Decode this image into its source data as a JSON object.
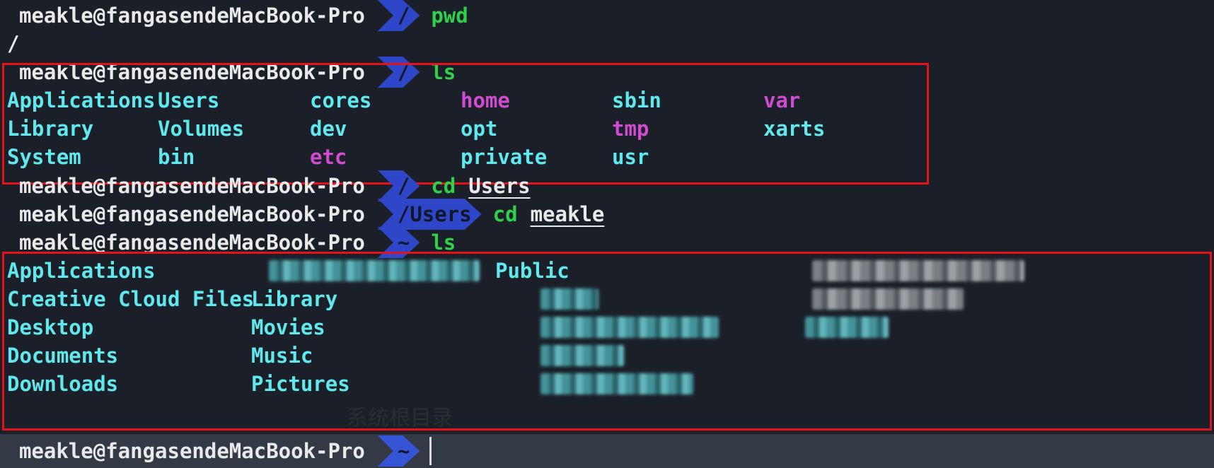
{
  "user": "meakle@fangasendeMacBook-Pro",
  "blocks": {
    "pwd": {
      "dir": "/",
      "cmd": "pwd",
      "output": "/"
    },
    "ls_root": {
      "dir": "/",
      "cmd": "ls",
      "rows": [
        [
          "Applications",
          "Users",
          "cores",
          "home",
          "sbin",
          "var"
        ],
        [
          "Library",
          "Volumes",
          "dev",
          "opt",
          "tmp",
          "xarts"
        ],
        [
          "System",
          "bin",
          "etc",
          "private",
          "usr",
          ""
        ]
      ]
    },
    "cd_users": {
      "dir": "/",
      "cmd": "cd",
      "arg": "Users"
    },
    "cd_meakle": {
      "dir": "/Users",
      "cmd": "cd",
      "arg": "meakle"
    },
    "ls_home": {
      "dir": "~",
      "cmd": "ls",
      "col1": [
        "Applications",
        "Creative Cloud Files",
        "Desktop",
        "Documents",
        "Downloads"
      ],
      "col2": [
        "",
        "Library",
        "Movies",
        "Music",
        "Pictures"
      ],
      "col3": [
        "Public",
        "",
        "",
        "",
        ""
      ]
    },
    "prompt": {
      "dir": "~"
    }
  },
  "colors": {
    "dir_cyan": "#5fe8ee",
    "special_magenta": "#cf4bcf",
    "command_green": "#2fd14a",
    "segment_blue": "#2e47c8",
    "highlight_red": "#e3121b"
  },
  "watermark": {
    "text": "系统根目录"
  }
}
